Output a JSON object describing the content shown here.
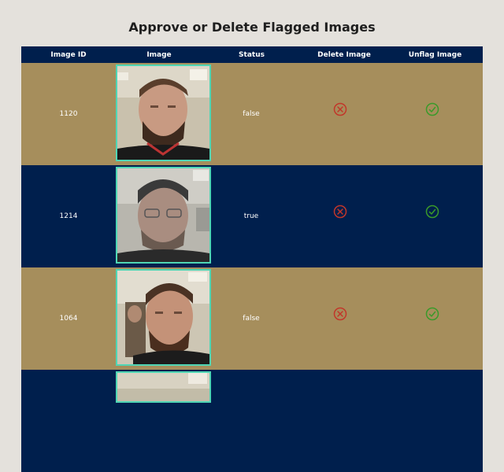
{
  "page": {
    "title": "Approve or Delete Flagged Images"
  },
  "table": {
    "headers": {
      "image_id": "Image ID",
      "image": "Image",
      "status": "Status",
      "delete": "Delete Image",
      "unflag": "Unflag Image"
    },
    "rows": [
      {
        "id": "1120",
        "status": "false",
        "delete_icon": "circle-x-icon",
        "unflag_icon": "circle-check-icon"
      },
      {
        "id": "1214",
        "status": "true",
        "delete_icon": "circle-x-icon",
        "unflag_icon": "circle-check-icon"
      },
      {
        "id": "1064",
        "status": "false",
        "delete_icon": "circle-x-icon",
        "unflag_icon": "circle-check-icon"
      }
    ]
  },
  "colors": {
    "row_tan": "#a68e5c",
    "row_navy": "#001f4d",
    "delete_icon": "#c2362a",
    "unflag_icon": "#3a9a2a",
    "photo_border": "#4fd6b5"
  }
}
